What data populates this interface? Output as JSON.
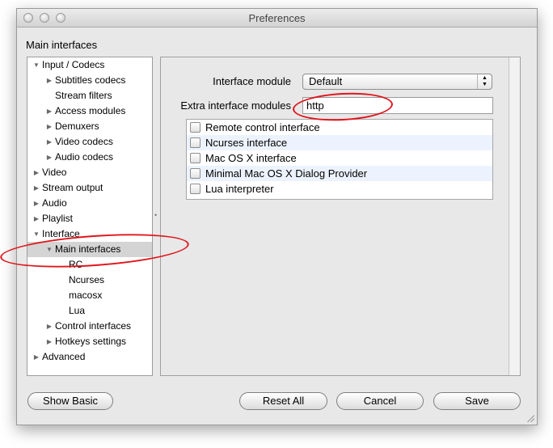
{
  "window": {
    "title": "Preferences"
  },
  "section_title": "Main interfaces",
  "tree": {
    "items": [
      {
        "label": "Input / Codecs",
        "level": 0,
        "expander": "expanded"
      },
      {
        "label": "Subtitles codecs",
        "level": 1,
        "expander": "collapsed"
      },
      {
        "label": "Stream filters",
        "level": 1,
        "expander": "none"
      },
      {
        "label": "Access modules",
        "level": 1,
        "expander": "collapsed"
      },
      {
        "label": "Demuxers",
        "level": 1,
        "expander": "collapsed"
      },
      {
        "label": "Video codecs",
        "level": 1,
        "expander": "collapsed"
      },
      {
        "label": "Audio codecs",
        "level": 1,
        "expander": "collapsed"
      },
      {
        "label": "Video",
        "level": 0,
        "expander": "collapsed"
      },
      {
        "label": "Stream output",
        "level": 0,
        "expander": "collapsed"
      },
      {
        "label": "Audio",
        "level": 0,
        "expander": "collapsed"
      },
      {
        "label": "Playlist",
        "level": 0,
        "expander": "collapsed"
      },
      {
        "label": "Interface",
        "level": 0,
        "expander": "expanded"
      },
      {
        "label": "Main interfaces",
        "level": 1,
        "expander": "expanded",
        "selected": true
      },
      {
        "label": "RC",
        "level": 2,
        "expander": "none"
      },
      {
        "label": "Ncurses",
        "level": 2,
        "expander": "none"
      },
      {
        "label": "macosx",
        "level": 2,
        "expander": "none"
      },
      {
        "label": "Lua",
        "level": 2,
        "expander": "none"
      },
      {
        "label": "Control interfaces",
        "level": 1,
        "expander": "collapsed"
      },
      {
        "label": "Hotkeys settings",
        "level": 1,
        "expander": "collapsed"
      },
      {
        "label": "Advanced",
        "level": 0,
        "expander": "collapsed"
      }
    ]
  },
  "panel": {
    "interface_module_label": "Interface module",
    "interface_module_value": "Default",
    "extra_modules_label": "Extra interface modules",
    "extra_modules_value": "http",
    "modules": [
      {
        "label": "Remote control interface",
        "checked": false
      },
      {
        "label": "Ncurses interface",
        "checked": false
      },
      {
        "label": "Mac OS X interface",
        "checked": false
      },
      {
        "label": "Minimal Mac OS X Dialog Provider",
        "checked": false
      },
      {
        "label": "Lua interpreter",
        "checked": false
      }
    ]
  },
  "buttons": {
    "show_basic": "Show Basic",
    "reset_all": "Reset All",
    "cancel": "Cancel",
    "save": "Save"
  },
  "colors": {
    "annotation": "#e0151b",
    "row_alt": "#edf3fe",
    "selection": "#d4d4d4"
  },
  "icons": {
    "expanded": "triangle-down-icon",
    "collapsed": "triangle-right-icon"
  }
}
